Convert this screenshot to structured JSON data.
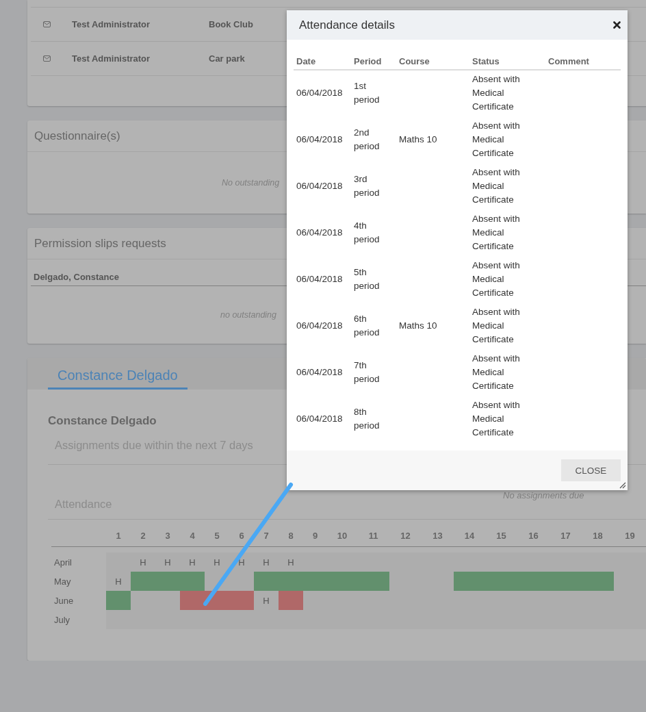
{
  "messages": {
    "rows": [
      {
        "sender": "Test Administrator",
        "group": "Book Club"
      },
      {
        "sender": "Test Administrator",
        "group": "Car park"
      }
    ]
  },
  "questionnaires": {
    "title": "Questionnaire(s)",
    "empty_text": "No outstanding"
  },
  "permission_slips": {
    "title": "Permission slips requests",
    "student": "Delgado, Constance",
    "empty_text": "no outstanding"
  },
  "student_panel": {
    "tabs": [
      {
        "label": "Constance Delgado",
        "selected": true
      }
    ],
    "name": "Constance Delgado",
    "assignments": {
      "title": "Assignments due within the next 7 days",
      "empty_text": "No assignments due"
    },
    "attendance": {
      "title": "Attendance",
      "days": [
        "1",
        "2",
        "3",
        "4",
        "5",
        "6",
        "7",
        "8",
        "9",
        "10",
        "11",
        "12",
        "13",
        "14",
        "15",
        "16",
        "17",
        "18",
        "19"
      ],
      "months": [
        {
          "name": "April",
          "cells": [
            {
              "kind": "empty"
            },
            {
              "kind": "holiday",
              "text": "H"
            },
            {
              "kind": "holiday",
              "text": "H"
            },
            {
              "kind": "holiday",
              "text": "H"
            },
            {
              "kind": "holiday",
              "text": "H"
            },
            {
              "kind": "holiday",
              "text": "H"
            },
            {
              "kind": "holiday",
              "text": "H"
            },
            {
              "kind": "holiday",
              "text": "H"
            },
            {
              "kind": "empty"
            },
            {
              "kind": "empty"
            },
            {
              "kind": "empty"
            },
            {
              "kind": "empty"
            },
            {
              "kind": "empty"
            },
            {
              "kind": "empty"
            },
            {
              "kind": "empty"
            },
            {
              "kind": "empty"
            },
            {
              "kind": "empty"
            },
            {
              "kind": "empty"
            },
            {
              "kind": "empty"
            }
          ]
        },
        {
          "name": "May",
          "cells": [
            {
              "kind": "holiday",
              "text": "H"
            },
            {
              "kind": "present"
            },
            {
              "kind": "present"
            },
            {
              "kind": "present"
            },
            {
              "kind": "empty"
            },
            {
              "kind": "empty"
            },
            {
              "kind": "present"
            },
            {
              "kind": "present"
            },
            {
              "kind": "present"
            },
            {
              "kind": "present"
            },
            {
              "kind": "present"
            },
            {
              "kind": "empty"
            },
            {
              "kind": "empty"
            },
            {
              "kind": "present"
            },
            {
              "kind": "present"
            },
            {
              "kind": "present"
            },
            {
              "kind": "present"
            },
            {
              "kind": "present"
            },
            {
              "kind": "empty"
            }
          ]
        },
        {
          "name": "June",
          "cells": [
            {
              "kind": "present"
            },
            {
              "kind": "empty"
            },
            {
              "kind": "empty"
            },
            {
              "kind": "absent"
            },
            {
              "kind": "absent"
            },
            {
              "kind": "absent"
            },
            {
              "kind": "holiday",
              "text": "H"
            },
            {
              "kind": "absent"
            },
            {
              "kind": "empty"
            },
            {
              "kind": "empty"
            },
            {
              "kind": "empty"
            },
            {
              "kind": "empty"
            },
            {
              "kind": "empty"
            },
            {
              "kind": "empty"
            },
            {
              "kind": "empty"
            },
            {
              "kind": "empty"
            },
            {
              "kind": "empty"
            },
            {
              "kind": "empty"
            },
            {
              "kind": "empty"
            }
          ]
        },
        {
          "name": "July",
          "cells": [
            {
              "kind": "empty"
            },
            {
              "kind": "empty"
            },
            {
              "kind": "empty"
            },
            {
              "kind": "empty"
            },
            {
              "kind": "empty"
            },
            {
              "kind": "empty"
            },
            {
              "kind": "empty"
            },
            {
              "kind": "empty"
            },
            {
              "kind": "empty"
            },
            {
              "kind": "empty"
            },
            {
              "kind": "empty"
            },
            {
              "kind": "empty"
            },
            {
              "kind": "empty"
            },
            {
              "kind": "empty"
            },
            {
              "kind": "empty"
            },
            {
              "kind": "empty"
            },
            {
              "kind": "empty"
            },
            {
              "kind": "empty"
            },
            {
              "kind": "empty"
            }
          ]
        }
      ]
    }
  },
  "dialog": {
    "title": "Attendance details",
    "columns": [
      "Date",
      "Period",
      "Course",
      "Status",
      "Comment"
    ],
    "rows": [
      {
        "date": "06/04/2018",
        "period": "1st period",
        "course": "",
        "status": "Absent with Medical Certificate"
      },
      {
        "date": "06/04/2018",
        "period": "2nd period",
        "course": "Maths 10",
        "status": "Absent with Medical Certificate"
      },
      {
        "date": "06/04/2018",
        "period": "3rd period",
        "course": "",
        "status": "Absent with Medical Certificate"
      },
      {
        "date": "06/04/2018",
        "period": "4th period",
        "course": "",
        "status": "Absent with Medical Certificate"
      },
      {
        "date": "06/04/2018",
        "period": "5th period",
        "course": "",
        "status": "Absent with Medical Certificate"
      },
      {
        "date": "06/04/2018",
        "period": "6th period",
        "course": "Maths 10",
        "status": "Absent with Medical Certificate"
      },
      {
        "date": "06/04/2018",
        "period": "7th period",
        "course": "",
        "status": "Absent with Medical Certificate"
      },
      {
        "date": "06/04/2018",
        "period": "8th period",
        "course": "",
        "status": "Absent with Medical Certificate"
      }
    ],
    "buttons": [
      "CLOSE"
    ]
  }
}
